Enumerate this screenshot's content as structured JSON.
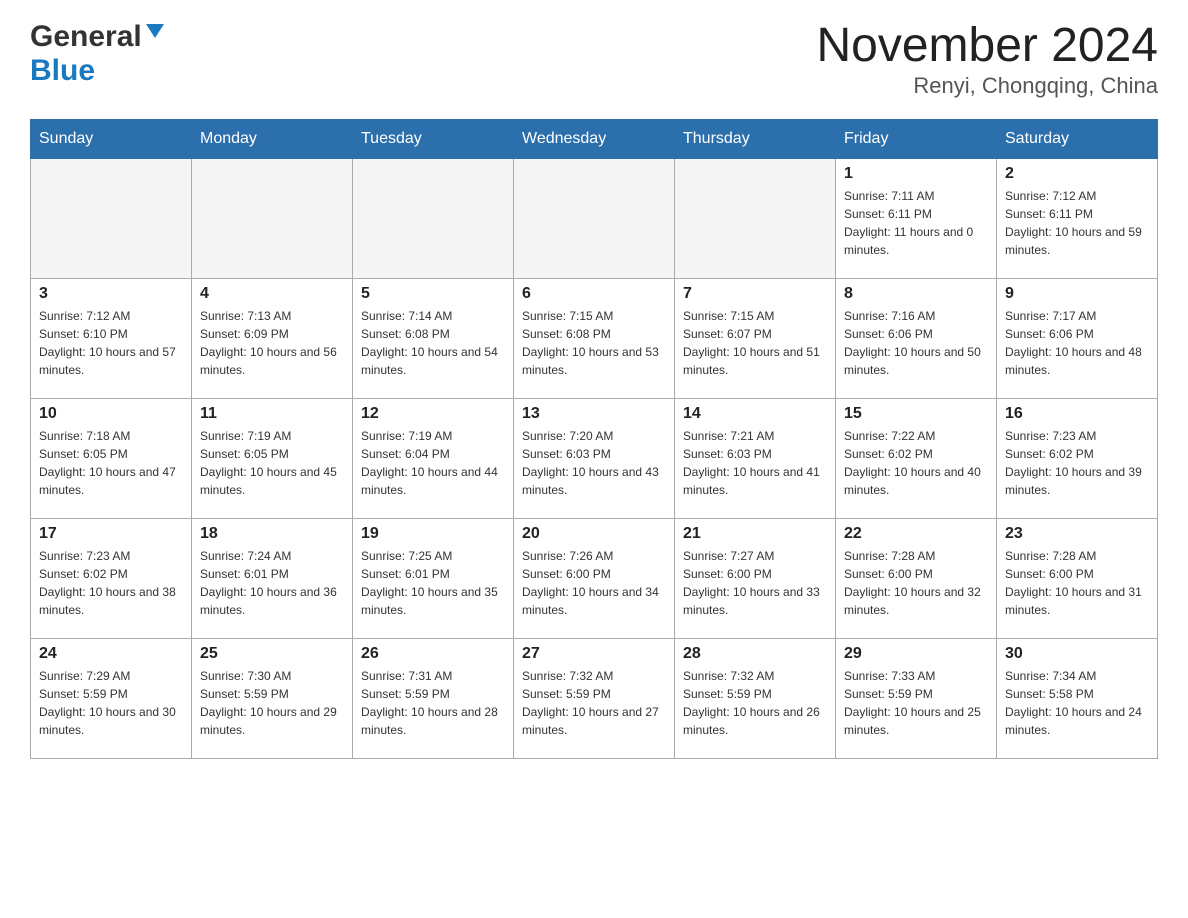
{
  "header": {
    "logo_general": "General",
    "logo_blue": "Blue",
    "title": "November 2024",
    "subtitle": "Renyi, Chongqing, China"
  },
  "calendar": {
    "days_of_week": [
      "Sunday",
      "Monday",
      "Tuesday",
      "Wednesday",
      "Thursday",
      "Friday",
      "Saturday"
    ],
    "weeks": [
      [
        {
          "day": "",
          "info": ""
        },
        {
          "day": "",
          "info": ""
        },
        {
          "day": "",
          "info": ""
        },
        {
          "day": "",
          "info": ""
        },
        {
          "day": "",
          "info": ""
        },
        {
          "day": "1",
          "info": "Sunrise: 7:11 AM\nSunset: 6:11 PM\nDaylight: 11 hours and 0 minutes."
        },
        {
          "day": "2",
          "info": "Sunrise: 7:12 AM\nSunset: 6:11 PM\nDaylight: 10 hours and 59 minutes."
        }
      ],
      [
        {
          "day": "3",
          "info": "Sunrise: 7:12 AM\nSunset: 6:10 PM\nDaylight: 10 hours and 57 minutes."
        },
        {
          "day": "4",
          "info": "Sunrise: 7:13 AM\nSunset: 6:09 PM\nDaylight: 10 hours and 56 minutes."
        },
        {
          "day": "5",
          "info": "Sunrise: 7:14 AM\nSunset: 6:08 PM\nDaylight: 10 hours and 54 minutes."
        },
        {
          "day": "6",
          "info": "Sunrise: 7:15 AM\nSunset: 6:08 PM\nDaylight: 10 hours and 53 minutes."
        },
        {
          "day": "7",
          "info": "Sunrise: 7:15 AM\nSunset: 6:07 PM\nDaylight: 10 hours and 51 minutes."
        },
        {
          "day": "8",
          "info": "Sunrise: 7:16 AM\nSunset: 6:06 PM\nDaylight: 10 hours and 50 minutes."
        },
        {
          "day": "9",
          "info": "Sunrise: 7:17 AM\nSunset: 6:06 PM\nDaylight: 10 hours and 48 minutes."
        }
      ],
      [
        {
          "day": "10",
          "info": "Sunrise: 7:18 AM\nSunset: 6:05 PM\nDaylight: 10 hours and 47 minutes."
        },
        {
          "day": "11",
          "info": "Sunrise: 7:19 AM\nSunset: 6:05 PM\nDaylight: 10 hours and 45 minutes."
        },
        {
          "day": "12",
          "info": "Sunrise: 7:19 AM\nSunset: 6:04 PM\nDaylight: 10 hours and 44 minutes."
        },
        {
          "day": "13",
          "info": "Sunrise: 7:20 AM\nSunset: 6:03 PM\nDaylight: 10 hours and 43 minutes."
        },
        {
          "day": "14",
          "info": "Sunrise: 7:21 AM\nSunset: 6:03 PM\nDaylight: 10 hours and 41 minutes."
        },
        {
          "day": "15",
          "info": "Sunrise: 7:22 AM\nSunset: 6:02 PM\nDaylight: 10 hours and 40 minutes."
        },
        {
          "day": "16",
          "info": "Sunrise: 7:23 AM\nSunset: 6:02 PM\nDaylight: 10 hours and 39 minutes."
        }
      ],
      [
        {
          "day": "17",
          "info": "Sunrise: 7:23 AM\nSunset: 6:02 PM\nDaylight: 10 hours and 38 minutes."
        },
        {
          "day": "18",
          "info": "Sunrise: 7:24 AM\nSunset: 6:01 PM\nDaylight: 10 hours and 36 minutes."
        },
        {
          "day": "19",
          "info": "Sunrise: 7:25 AM\nSunset: 6:01 PM\nDaylight: 10 hours and 35 minutes."
        },
        {
          "day": "20",
          "info": "Sunrise: 7:26 AM\nSunset: 6:00 PM\nDaylight: 10 hours and 34 minutes."
        },
        {
          "day": "21",
          "info": "Sunrise: 7:27 AM\nSunset: 6:00 PM\nDaylight: 10 hours and 33 minutes."
        },
        {
          "day": "22",
          "info": "Sunrise: 7:28 AM\nSunset: 6:00 PM\nDaylight: 10 hours and 32 minutes."
        },
        {
          "day": "23",
          "info": "Sunrise: 7:28 AM\nSunset: 6:00 PM\nDaylight: 10 hours and 31 minutes."
        }
      ],
      [
        {
          "day": "24",
          "info": "Sunrise: 7:29 AM\nSunset: 5:59 PM\nDaylight: 10 hours and 30 minutes."
        },
        {
          "day": "25",
          "info": "Sunrise: 7:30 AM\nSunset: 5:59 PM\nDaylight: 10 hours and 29 minutes."
        },
        {
          "day": "26",
          "info": "Sunrise: 7:31 AM\nSunset: 5:59 PM\nDaylight: 10 hours and 28 minutes."
        },
        {
          "day": "27",
          "info": "Sunrise: 7:32 AM\nSunset: 5:59 PM\nDaylight: 10 hours and 27 minutes."
        },
        {
          "day": "28",
          "info": "Sunrise: 7:32 AM\nSunset: 5:59 PM\nDaylight: 10 hours and 26 minutes."
        },
        {
          "day": "29",
          "info": "Sunrise: 7:33 AM\nSunset: 5:59 PM\nDaylight: 10 hours and 25 minutes."
        },
        {
          "day": "30",
          "info": "Sunrise: 7:34 AM\nSunset: 5:58 PM\nDaylight: 10 hours and 24 minutes."
        }
      ]
    ]
  }
}
